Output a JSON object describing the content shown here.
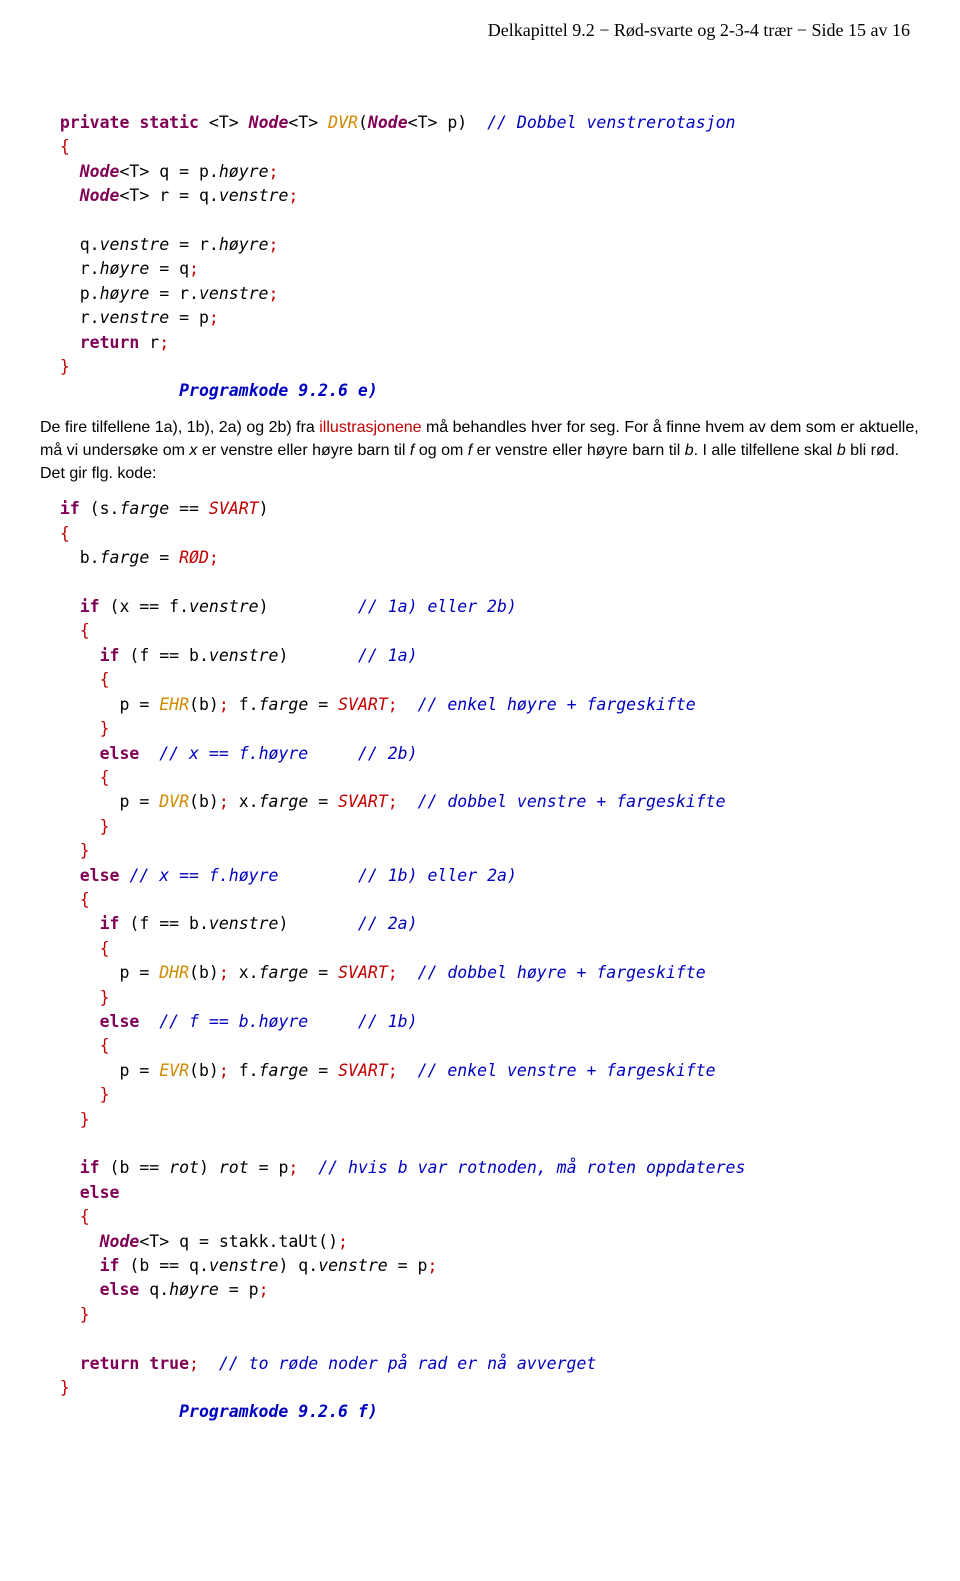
{
  "header": "Delkapittel 9.2  −  Rød-svarte og 2-3-4 trær  −  Side 15 av 16",
  "code1": {
    "l1_a": "private",
    "l1_b": "static",
    "l1_c": "Node",
    "l1_d": "DVR",
    "l1_e": "Node",
    "l1_cmt": "// Dobbel venstrerotasjon",
    "l3a": "Node",
    "l3b": "høyre",
    "l4a": "Node",
    "l4b": "venstre",
    "l6a": "venstre",
    "l6b": "høyre",
    "l7a": "høyre",
    "l8a": "høyre",
    "l8b": "venstre",
    "l9a": "venstre",
    "l10": "return",
    "cap": "Programkode 9.2.6 e)"
  },
  "prose1_a": "De fire tilfellene 1a), 1b), 2a) og 2b) fra ",
  "prose1_link": "illustrasjonene",
  "prose1_b": " må behandles hver for seg. For å finne hvem av dem som er aktuelle, må vi undersøke om ",
  "prose1_x": "x",
  "prose1_c": " er venstre eller høyre barn til ",
  "prose1_f": "f",
  "prose1_d": " og om ",
  "prose1_f2": "f",
  "prose1_e": " er venstre eller høyre barn til ",
  "prose1_bv": "b",
  "prose1_f3": ". I alle tilfellene skal ",
  "prose1_bv2": "b",
  "prose1_g": " bli rød. Det gir flg. kode:",
  "code2": {
    "if": "if",
    "else": "else",
    "return": "return",
    "true": "true",
    "farge": "farge",
    "SVART": "SVART",
    "ROD": "RØD",
    "venstre": "venstre",
    "hoyre": "høyre",
    "EHR": "EHR",
    "DVR": "DVR",
    "DHR": "DHR",
    "EVR": "EVR",
    "Node": "Node",
    "rot": "rot",
    "c1a2b": "// 1a) eller 2b)",
    "c1a": "// 1a)",
    "cEnkHoy": "// enkel høyre + fargeskifte",
    "cxfh": "// x == f.høyre",
    "c2b": "// 2b)",
    "cDobV": "// dobbel venstre + fargeskifte",
    "cxfh2": "// x == f.høyre",
    "c1b2a": "// 1b) eller 2a)",
    "c2a": "// 2a)",
    "cDobH": "// dobbel høyre + fargeskifte",
    "cffb": "// f == b.høyre",
    "c1b": "// 1b)",
    "cEnkV": "// enkel venstre + fargeskifte",
    "cRot": "// hvis b var rotnoden, må roten oppdateres",
    "cAvv": "// to røde noder på rad er nå avverget",
    "cap": "Programkode 9.2.6 f)"
  }
}
